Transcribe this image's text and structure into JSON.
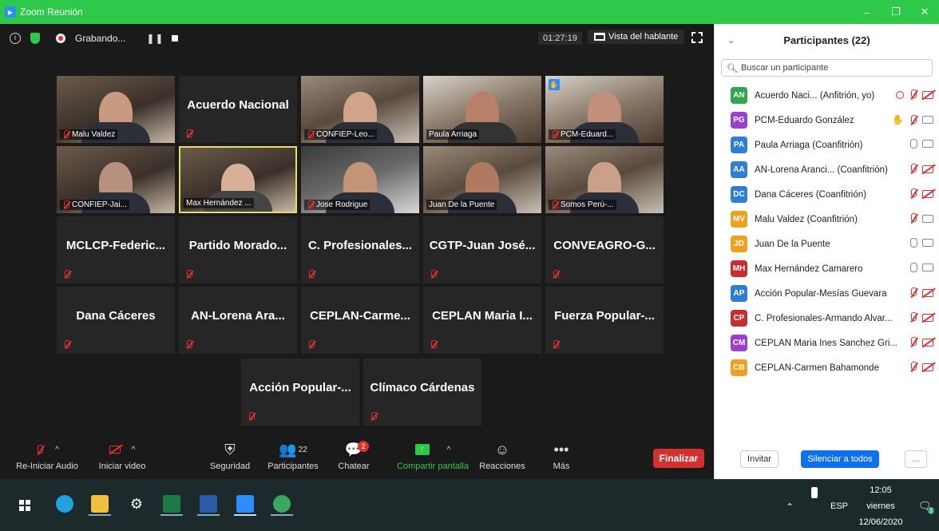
{
  "window": {
    "title": "Zoom Reunión"
  },
  "meeting": {
    "recording_label": "Grabando...",
    "pause_label": "❚❚",
    "timer": "01:27:19",
    "view_label": "Vista del hablante"
  },
  "tiles": [
    {
      "name": "Malu Valdez"
    },
    {
      "name": "Acuerdo Nacional"
    },
    {
      "name": "CONFIEP-Leo..."
    },
    {
      "name": "Paula Arriaga"
    },
    {
      "name": "PCM-Eduard..."
    },
    {
      "name": "CONFIEP-Jai..."
    },
    {
      "name": "Max Hernández ..."
    },
    {
      "name": "Jose Rodrigue"
    },
    {
      "name": "Juan De la Puente"
    },
    {
      "name": "Somos Perú-..."
    },
    {
      "name": "MCLCP-Federic..."
    },
    {
      "name": "Partido Morado..."
    },
    {
      "name": "C. Profesionales..."
    },
    {
      "name": "CGTP-Juan José..."
    },
    {
      "name": "CONVEAGRO-G..."
    },
    {
      "name": "Dana Cáceres"
    },
    {
      "name": "AN-Lorena Ara..."
    },
    {
      "name": "CEPLAN-Carme..."
    },
    {
      "name": "CEPLAN Maria I..."
    },
    {
      "name": "Fuerza Popular-..."
    },
    {
      "name": "Acción Popular-..."
    },
    {
      "name": "Clímaco Cárdenas"
    }
  ],
  "toolbar": {
    "audio": "Re-Iniciar Audio",
    "video": "Iniciar video",
    "security": "Seguridad",
    "participants": "Participantes",
    "participants_count": "22",
    "chat": "Chatear",
    "chat_badge": "2",
    "share": "Compartir pantalla",
    "reactions": "Reacciones",
    "more": "Más",
    "end": "Finalizar"
  },
  "panel": {
    "title": "Participantes (22)",
    "search_placeholder": "Buscar un participante",
    "invite": "Invitar",
    "mute_all": "Silenciar a todos",
    "more": "...",
    "participants": [
      {
        "initials": "AN",
        "name": "Acuerdo Naci... (Anfitrión, yo)",
        "color": "#2ea84a"
      },
      {
        "initials": "PG",
        "name": "PCM-Eduardo González",
        "color": "#9b3fd1"
      },
      {
        "initials": "PA",
        "name": "Paula Arriaga (Coanfitrión)",
        "color": "#2d7fd3"
      },
      {
        "initials": "AA",
        "name": "AN-Lorena Aranci...  (Coanfitrión)",
        "color": "#2d7fd3"
      },
      {
        "initials": "DC",
        "name": "Dana Cáceres (Coanfitrión)",
        "color": "#2d7fd3"
      },
      {
        "initials": "MV",
        "name": "Malu Valdez (Coanfitrión)",
        "color": "#f0a020"
      },
      {
        "initials": "JD",
        "name": "Juan De la Puente",
        "color": "#f0a020"
      },
      {
        "initials": "MH",
        "name": "Max Hernández Camarero",
        "color": "#c82d2d"
      },
      {
        "initials": "AP",
        "name": "Acción Popular-Mesías Guevara",
        "color": "#2d7fd3"
      },
      {
        "initials": "CP",
        "name": "C. Profesionales-Armando Alvar...",
        "color": "#c82d2d"
      },
      {
        "initials": "CM",
        "name": "CEPLAN Maria Ines Sanchez Gri...",
        "color": "#9b3fd1"
      },
      {
        "initials": "CB",
        "name": "CEPLAN-Carmen Bahamonde",
        "color": "#f0a020"
      }
    ]
  },
  "taskbar": {
    "lang": "ESP",
    "time": "12:05",
    "day": "viernes",
    "date": "12/06/2020",
    "notif_count": "3"
  }
}
